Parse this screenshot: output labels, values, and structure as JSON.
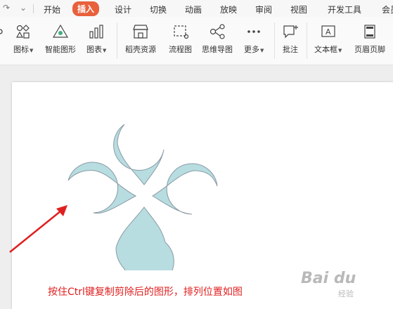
{
  "menubar": {
    "quick_redo": "↷",
    "quick_more": "⌄",
    "items": [
      "开始",
      "插入",
      "设计",
      "切换",
      "动画",
      "放映",
      "审阅",
      "视图",
      "开发工具",
      "会员"
    ],
    "active": "插入",
    "active_color": "#e8603c"
  },
  "ribbon": {
    "icons": "图标",
    "smartart": "智能图形",
    "chart": "图表",
    "resources": "稻壳资源",
    "flowchart": "流程图",
    "mindmap": "思维导图",
    "more": "更多",
    "comment": "批注",
    "textbox": "文本框",
    "header_footer": "页眉页脚"
  },
  "slide": {
    "instruction": "按住Ctrl键复制剪除后的图形，排列位置如图",
    "instruction_color": "#e02020",
    "shape_fill": "#b7dde0",
    "shape_stroke": "#8a9aa5"
  },
  "watermark": {
    "text": "Bai du",
    "sub": "经验"
  }
}
